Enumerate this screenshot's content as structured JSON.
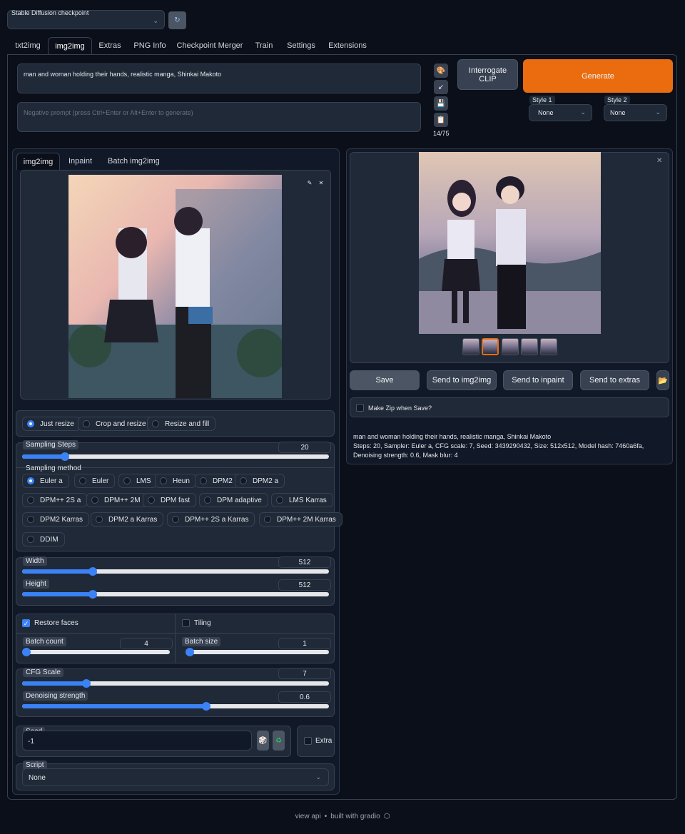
{
  "checkpoint": {
    "label": "Stable Diffusion checkpoint",
    "value": ""
  },
  "tabs": [
    "txt2img",
    "img2img",
    "Extras",
    "PNG Info",
    "Checkpoint Merger",
    "Train",
    "Settings",
    "Extensions"
  ],
  "prompt": {
    "value": "man and woman holding their hands, realistic manga, Shinkai Makoto",
    "negative_placeholder": "Negative prompt (press Ctrl+Enter or Alt+Enter to generate)",
    "token_count": "14/75"
  },
  "buttons": {
    "interrogate": "Interrogate CLIP",
    "generate": "Generate"
  },
  "styles": {
    "style1_label": "Style 1",
    "style1_value": "None",
    "style2_label": "Style 2",
    "style2_value": "None"
  },
  "subtabs": [
    "img2img",
    "Inpaint",
    "Batch img2img"
  ],
  "resize_modes": [
    "Just resize",
    "Crop and resize",
    "Resize and fill"
  ],
  "sampling_steps": {
    "label": "Sampling Steps",
    "value": "20",
    "fraction": 0.14
  },
  "sampling_method": {
    "label": "Sampling method",
    "selected": "Euler a",
    "rows": [
      [
        "Euler a",
        "Euler",
        "LMS",
        "Heun",
        "DPM2",
        "DPM2 a"
      ],
      [
        "DPM++ 2S a",
        "DPM++ 2M",
        "DPM fast",
        "DPM adaptive",
        "LMS Karras"
      ],
      [
        "DPM2 Karras",
        "DPM2 a Karras",
        "DPM++ 2S a Karras",
        "DPM++ 2M Karras"
      ],
      [
        "DDIM"
      ]
    ]
  },
  "width": {
    "label": "Width",
    "value": "512",
    "fraction": 0.23
  },
  "height": {
    "label": "Height",
    "value": "512",
    "fraction": 0.23
  },
  "restore_faces": {
    "label": "Restore faces",
    "checked": true
  },
  "tiling": {
    "label": "Tiling",
    "checked": false
  },
  "batch_count": {
    "label": "Batch count",
    "value": "4",
    "fraction": 0.03
  },
  "batch_size": {
    "label": "Batch size",
    "value": "1",
    "fraction": 0.0
  },
  "cfg_scale": {
    "label": "CFG Scale",
    "value": "7",
    "fraction": 0.21
  },
  "denoising": {
    "label": "Denoising strength",
    "value": "0.6",
    "fraction": 0.6
  },
  "seed": {
    "label": "Seed",
    "value": "-1",
    "extra_label": "Extra"
  },
  "script": {
    "label": "Script",
    "value": "None"
  },
  "output_buttons": {
    "save": "Save",
    "send_img2img": "Send to img2img",
    "send_inpaint": "Send to inpaint",
    "send_extras": "Send to extras"
  },
  "make_zip": {
    "label": "Make Zip when Save?"
  },
  "info": {
    "line1": "man and woman holding their hands, realistic manga, Shinkai Makoto",
    "line2": "Steps: 20, Sampler: Euler a, CFG scale: 7, Seed: 3439290432, Size: 512x512, Model hash: 7460a6fa, Denoising strength: 0.6, Mask blur: 4"
  },
  "footer": {
    "view_api": "view api",
    "sep": "•",
    "built": "built with gradio"
  },
  "icons": [
    "refresh-icon",
    "paint-icon",
    "arrow-icon",
    "save-icon",
    "clipboard-icon",
    "edit-icon",
    "close-icon",
    "folder-icon",
    "dice-icon",
    "recycle-icon",
    "chevron-down-icon",
    "gradio-logo-icon"
  ],
  "colors": {
    "accent": "#ea6c0e",
    "slider": "#3b82f6",
    "background": "#0b0f19"
  }
}
